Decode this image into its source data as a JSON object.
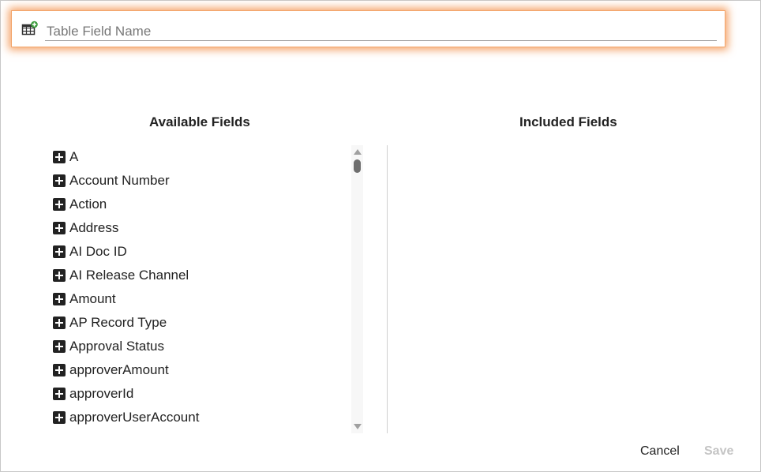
{
  "name_field": {
    "placeholder": "Table Field Name",
    "value": ""
  },
  "available_fields": {
    "heading": "Available Fields",
    "items": [
      "A",
      "Account Number",
      "Action",
      "Address",
      "AI Doc ID",
      "AI Release Channel",
      "Amount",
      "AP Record Type",
      "Approval Status",
      "approverAmount",
      "approverId",
      "approverUserAccount"
    ]
  },
  "included_fields": {
    "heading": "Included Fields",
    "items": []
  },
  "footer": {
    "cancel_label": "Cancel",
    "save_label": "Save"
  },
  "colors": {
    "focus_glow": "#f08232",
    "add_badge": "#3a9a3a",
    "disabled_text": "#c4c4c4"
  },
  "icons": {
    "field_icon": "table-add-icon",
    "item_icon": "plus-square-icon"
  }
}
